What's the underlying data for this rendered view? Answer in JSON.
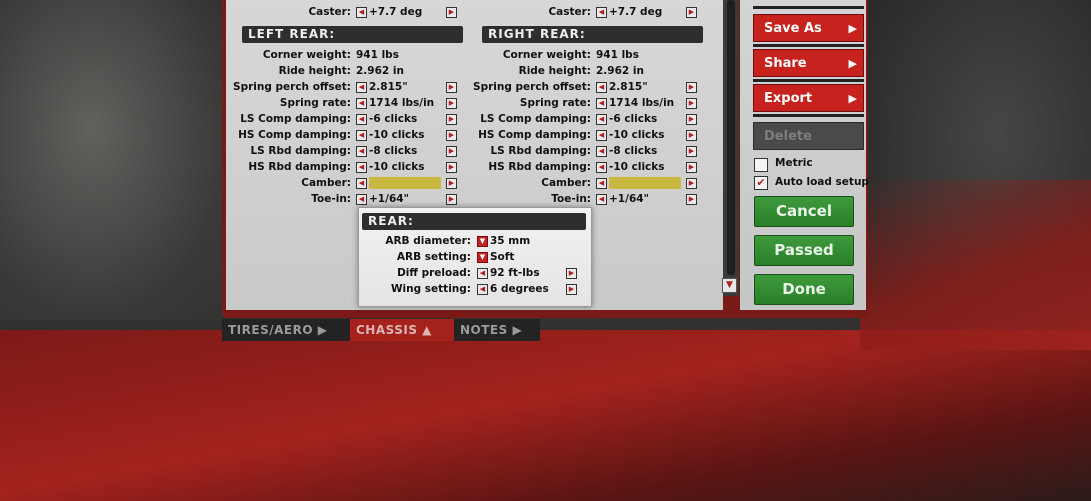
{
  "top_row": {
    "left": {
      "label": "Caster:",
      "value": "+7.7 deg"
    },
    "right": {
      "label": "Caster:",
      "value": "+7.7 deg"
    }
  },
  "left_rear": {
    "heading": "LEFT REAR:",
    "rows": [
      {
        "label": "Corner weight:",
        "value": "941 lbs"
      },
      {
        "label": "Ride height:",
        "value": "2.962 in"
      },
      {
        "label": "Spring perch offset:",
        "value": "2.815\""
      },
      {
        "label": "Spring rate:",
        "value": "1714 lbs/in"
      },
      {
        "label": "LS Comp damping:",
        "value": "-6 clicks"
      },
      {
        "label": "HS Comp damping:",
        "value": "-10 clicks"
      },
      {
        "label": "LS Rbd damping:",
        "value": "-8 clicks"
      },
      {
        "label": "HS Rbd damping:",
        "value": "-10 clicks"
      },
      {
        "label": "Camber:",
        "value": ""
      },
      {
        "label": "Toe-in:",
        "value": "+1/64\""
      }
    ]
  },
  "right_rear": {
    "heading": "RIGHT REAR:",
    "rows": [
      {
        "label": "Corner weight:",
        "value": "941 lbs"
      },
      {
        "label": "Ride height:",
        "value": "2.962 in"
      },
      {
        "label": "Spring perch offset:",
        "value": "2.815\""
      },
      {
        "label": "Spring rate:",
        "value": "1714 lbs/in"
      },
      {
        "label": "LS Comp damping:",
        "value": "-6 clicks"
      },
      {
        "label": "HS Comp damping:",
        "value": "-10 clicks"
      },
      {
        "label": "LS Rbd damping:",
        "value": "-8 clicks"
      },
      {
        "label": "HS Rbd damping:",
        "value": "-10 clicks"
      },
      {
        "label": "Camber:",
        "value": ""
      },
      {
        "label": "Toe-in:",
        "value": "+1/64\""
      }
    ]
  },
  "rear_popup": {
    "heading": "REAR:",
    "rows": [
      {
        "label": "ARB diameter:",
        "value": "35 mm"
      },
      {
        "label": "ARB setting:",
        "value": "Soft"
      },
      {
        "label": "Diff preload:",
        "value": "92 ft-lbs"
      },
      {
        "label": "Wing setting:",
        "value": "6 degrees"
      }
    ]
  },
  "side": {
    "save_as": "Save As",
    "share": "Share",
    "export": "Export",
    "delete": "Delete",
    "metric_label": "Metric",
    "metric_checked": false,
    "autoload_label": "Auto load setup",
    "autoload_checked": true,
    "cancel": "Cancel",
    "passed": "Passed",
    "done": "Done"
  },
  "tabs": [
    {
      "label": "TIRES/AERO ▶"
    },
    {
      "label": "CHASSIS ▲"
    },
    {
      "label": "NOTES ▶"
    }
  ],
  "icons": {
    "left_arrow": "◀",
    "right_arrow": "▶",
    "dropdown": "▼",
    "check": "✔"
  },
  "colors": {
    "accent_red": "#c8221e",
    "green": "#2b7f2a",
    "camber_yellow": "#c9b941"
  }
}
